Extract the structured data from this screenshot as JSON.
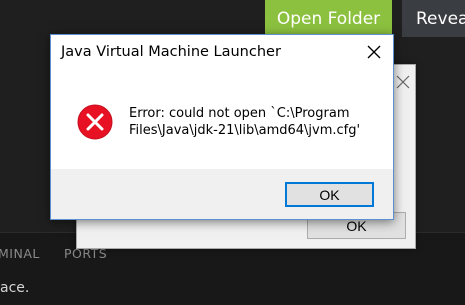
{
  "background": {
    "open_folder_label": "Open Folder",
    "reveal_label": "Revea",
    "panel_tabs": [
      "MINAL",
      "PORTS"
    ],
    "panel_text": "ace.",
    "accent_color": "#8cc13f"
  },
  "back_dialog": {
    "close_icon": "close-icon",
    "ok_label": "OK"
  },
  "dialog": {
    "title": "Java Virtual Machine Launcher",
    "icon": "error-icon",
    "message": "Error: could not open `C:\\Program Files\\Java\\jdk-21\\lib\\amd64\\jvm.cfg'",
    "ok_label": "OK",
    "close_icon": "close-icon",
    "error_color": "#e81123",
    "focus_color": "#0078d7"
  }
}
